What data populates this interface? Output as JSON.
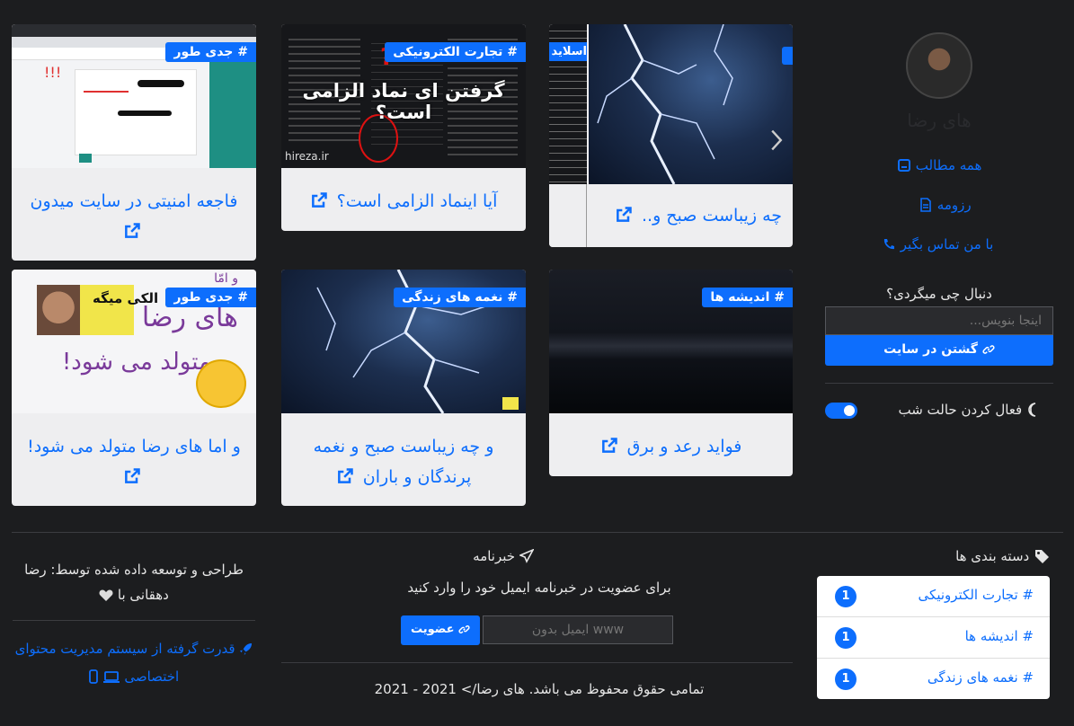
{
  "sidebar": {
    "name": "های رضا",
    "links": {
      "all_posts": "همه مطالب",
      "resume": "رزومه",
      "contact": "با من تماس بگیر"
    },
    "search": {
      "label": "دنبال چی میگردی؟",
      "placeholder": "اینجا بنویس...",
      "button": "گشتن در سایت"
    },
    "dark_mode_label": "فعال کردن حالت شب"
  },
  "cards": [
    {
      "tag": "# جدی طور",
      "title": "فاجعه امنیتی در سایت میدون"
    },
    {
      "tag": "# تجارت الکترونیکی",
      "title": "آیا اینماد الزامی است؟",
      "thumb_text": "گرفتن ای نماد الزامی است؟",
      "thumb_caption": "hireza.ir"
    },
    {
      "tag": "# اسلاید",
      "title": "چه زیباست صبح و..",
      "slider_prev_tag": "اسلاید"
    },
    {
      "tag": "# جدی طور",
      "title": "و اما های رضا متولد می شود!",
      "thumb_lines": [
        "و امّا",
        "های رضا",
        "متولد می شود!"
      ],
      "thumb_sign": "الکی میگه"
    },
    {
      "tag": "# نغمه های زندگی",
      "title": "و چه زیباست صبح و نغمه پرندگان و باران"
    },
    {
      "tag": "# اندیشه ها",
      "title": "فواید رعد و برق"
    }
  ],
  "footer": {
    "categories_heading": "دسته بندی ها",
    "categories": [
      {
        "name": "# تجارت الکترونیکی",
        "count": "1"
      },
      {
        "name": "# اندیشه ها",
        "count": "1"
      },
      {
        "name": "# نغمه های زندگی",
        "count": "1"
      }
    ],
    "newsletter": {
      "heading": "خبرنامه",
      "text": "برای عضویت در خبرنامه ایمیل خود را وارد کنید",
      "placeholder": "ایمیل بدون www",
      "button": "عضویت"
    },
    "copyright": "تمامی حقوق محفوظ می باشد. های رضا/> 2021 - 2021",
    "credit": "طراحی و توسعه داده شده توسط: رضا دهقانی با",
    "powered": "قدرت گرفته از سیستم مدیریت محتوای اختصاصی"
  },
  "colors": {
    "accent": "#0d6efd",
    "background": "#1c1d1f",
    "card": "#eeeef0"
  }
}
